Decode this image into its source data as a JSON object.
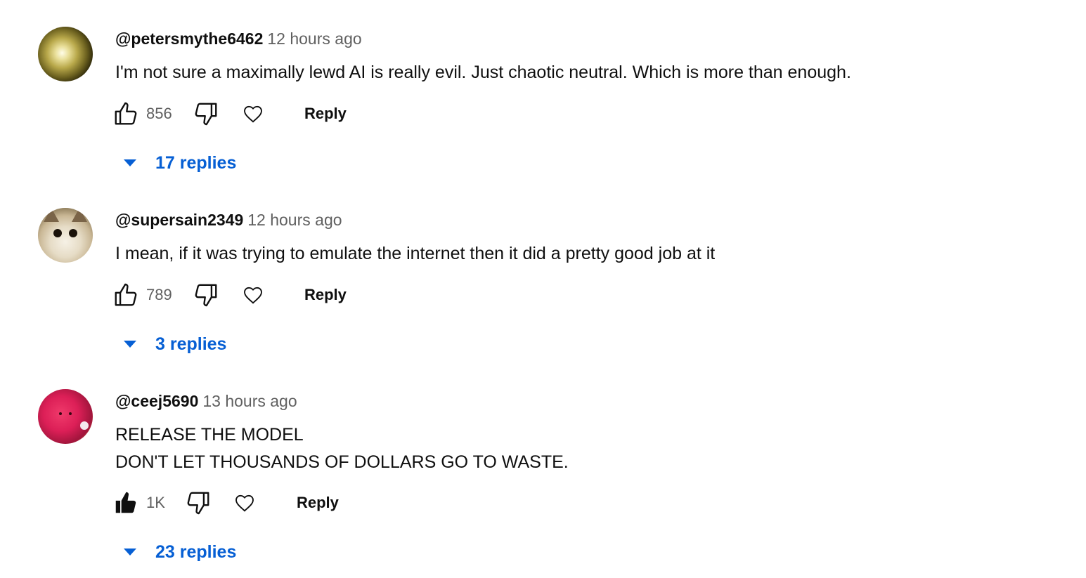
{
  "comments": [
    {
      "author": "@petersmythe6462",
      "time": "12 hours ago",
      "lines": [
        "I'm not sure a maximally lewd AI is really evil. Just chaotic neutral. Which is more than enough."
      ],
      "likes": "856",
      "liked": false,
      "reply_label": "Reply",
      "replies_label": "17 replies",
      "avatar": "sun-glow-avatar"
    },
    {
      "author": "@supersain2349",
      "time": "12 hours ago",
      "lines": [
        "I mean, if it was trying to emulate the internet then it did a pretty good job at it"
      ],
      "likes": "789",
      "liked": false,
      "reply_label": "Reply",
      "replies_label": "3 replies",
      "avatar": "cat-avatar"
    },
    {
      "author": "@ceej5690",
      "time": "13 hours ago",
      "lines": [
        "RELEASE THE MODEL",
        "DON'T LET THOUSANDS OF DOLLARS GO TO WASTE."
      ],
      "likes": "1K",
      "liked": true,
      "reply_label": "Reply",
      "replies_label": "23 replies",
      "avatar": "pink-blob-avatar"
    }
  ],
  "colors": {
    "link": "#065fd4",
    "text": "#0f0f0f",
    "secondary": "#606060"
  }
}
